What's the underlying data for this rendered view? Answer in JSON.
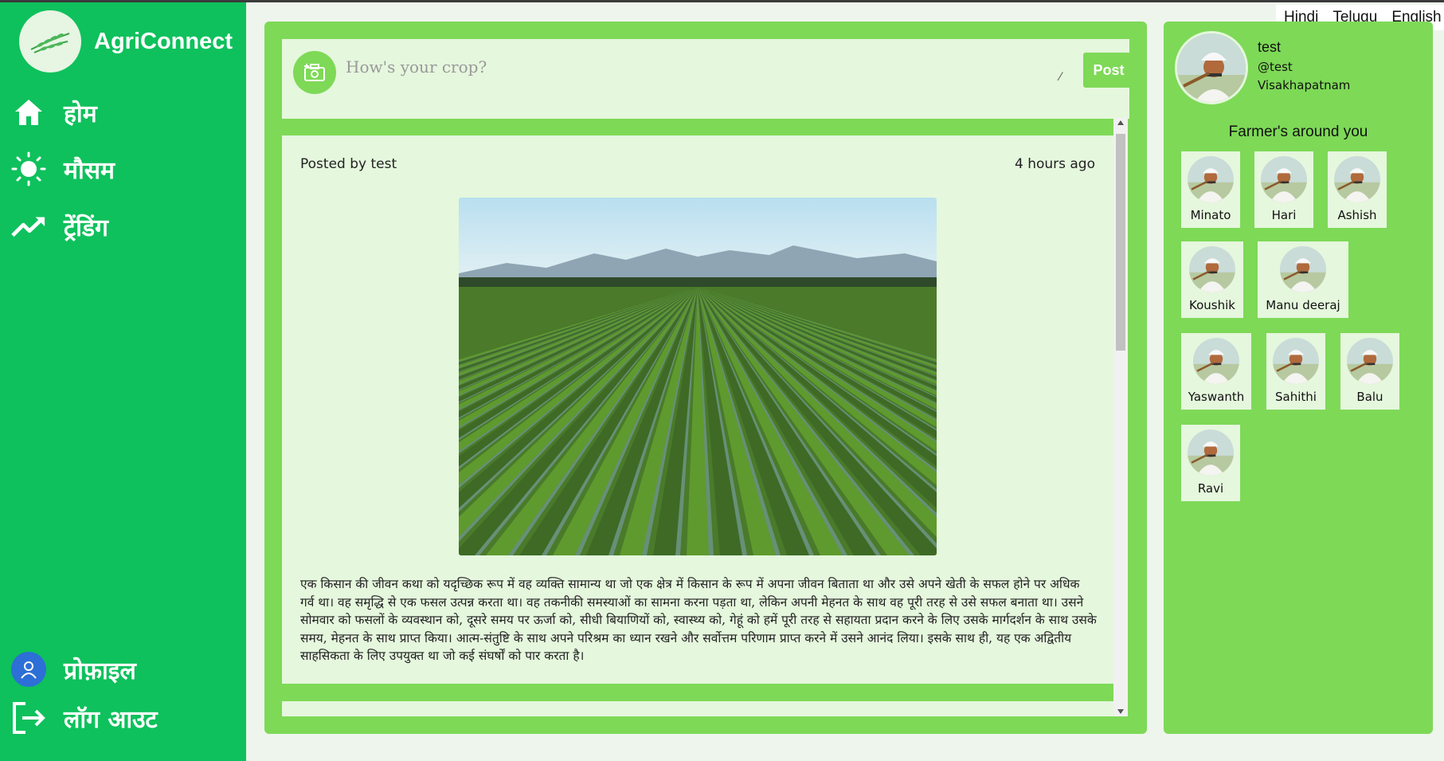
{
  "colors": {
    "sidebar": "#0ec15c",
    "panel": "#7ed957",
    "card": "#e5f7dd"
  },
  "sidebar": {
    "brand": "AgriConnect",
    "nav": [
      {
        "label": "होम",
        "icon": "home-icon"
      },
      {
        "label": "मौसम",
        "icon": "sun-icon"
      },
      {
        "label": "ट्रेंडिंग",
        "icon": "trending-icon"
      }
    ],
    "profile_label": "प्रोफ़ाइल",
    "logout_label": "लॉग आउट"
  },
  "languages": [
    "Hindi",
    "Telugu",
    "English"
  ],
  "composer": {
    "placeholder": "How's your crop?",
    "post_label": "Post"
  },
  "post": {
    "author": "Posted by test",
    "time": "4 hours ago",
    "image_icon": "crop-field-photo",
    "text": "एक किसान की जीवन कथा को यदृच्छिक रूप में वह व्यक्ति सामान्य था जो एक क्षेत्र में किसान के रूप में अपना जीवन बिताता था और उसे अपने खेती के सफल होने पर अधिक गर्व था। वह समृद्धि से एक फसल उत्पन्न करता था। वह तकनीकी समस्याओं का सामना करना पड़ता था, लेकिन अपनी मेहनत के साथ वह पूरी तरह से उसे सफल बनाता था। उसने सोमवार को फसलों के व्यवस्थान को, दूसरे समय पर ऊर्जा को, सीधी बियाणियों को, स्वास्थ्य को, गेहूं को हमें पूरी तरह से सहायता प्रदान करने के लिए उसके मार्गदर्शन के साथ उसके समय, मेहनत के साथ प्राप्त किया। आत्म-संतुष्टि के साथ अपने परिश्रम का ध्यान रखने और सर्वोत्तम परिणाम प्राप्त करने में उसने आनंद लिया। इसके साथ ही, यह एक अद्वितीय साहसिकता के लिए उपयुक्त था जो कई संघर्षों को पार करता है।"
  },
  "user": {
    "name": "test",
    "handle": "@test",
    "city": "Visakhapatnam"
  },
  "farmers_title": "Farmer's around you",
  "farmers": [
    "Minato",
    "Hari",
    "Ashish",
    "Koushik",
    "Manu deeraj",
    "Yaswanth",
    "Sahithi",
    "Balu",
    "Ravi"
  ]
}
